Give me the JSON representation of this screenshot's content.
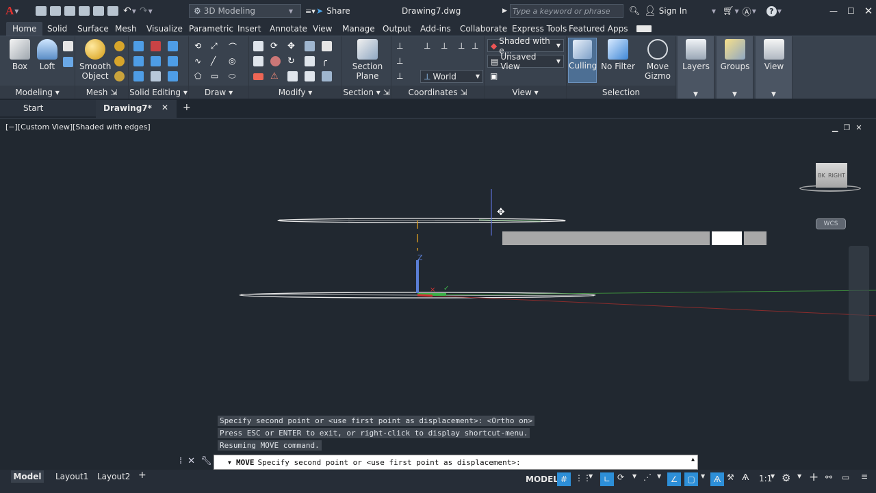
{
  "title_bar": {
    "workspace": "3D Modeling",
    "share_label": "Share",
    "file_name": "Drawing7.dwg",
    "search_placeholder": "Type a keyword or phrase",
    "sign_in": "Sign In"
  },
  "ribbon_tabs": [
    "Home",
    "Solid",
    "Surface",
    "Mesh",
    "Visualize",
    "Parametric",
    "Insert",
    "Annotate",
    "View",
    "Manage",
    "Output",
    "Add-ins",
    "Collaborate",
    "Express Tools",
    "Featured Apps"
  ],
  "ribbon": {
    "box": "Box",
    "loft": "Loft",
    "smooth_object_1": "Smooth",
    "smooth_object_2": "Object",
    "section_plane_1": "Section",
    "section_plane_2": "Plane",
    "visual_style": "Shaded with e...",
    "view_name": "Unsaved View",
    "ucs": "World",
    "culling": "Culling",
    "no_filter": "No Filter",
    "move_gizmo_1": "Move",
    "move_gizmo_2": "Gizmo",
    "layers": "Layers",
    "groups": "Groups",
    "view": "View",
    "panels": {
      "modeling": "Modeling",
      "mesh": "Mesh",
      "solid_editing": "Solid Editing",
      "draw": "Draw",
      "modify": "Modify",
      "section": "Section",
      "coordinates": "Coordinates",
      "view": "View",
      "selection": "Selection"
    }
  },
  "doc_tabs": {
    "start": "Start",
    "drawing": "Drawing7*"
  },
  "viewport": {
    "label": "[−][Custom View][Shaded with edges]",
    "viewcube_face": "RIGHT",
    "viewcube_side": "BK",
    "wcs": "WCS",
    "ucs_z": "Z"
  },
  "command": {
    "history": [
      "Specify second point or <use first point as displacement>:  <Ortho on>",
      "Press ESC or ENTER to exit, or right-click to display shortcut-menu.",
      "Resuming MOVE command."
    ],
    "prompt_cmd": "MOVE",
    "prompt_text": "Specify second point or <use first point as displacement>:"
  },
  "status": {
    "model_tab": "Model",
    "layout1": "Layout1",
    "layout2": "Layout2",
    "model_label": "MODEL",
    "scale": "1:1"
  },
  "colors": {
    "accent": "#2d8fd8",
    "titlebar": "#262d37",
    "ribbon": "#39424e",
    "viewport": "#212830"
  }
}
